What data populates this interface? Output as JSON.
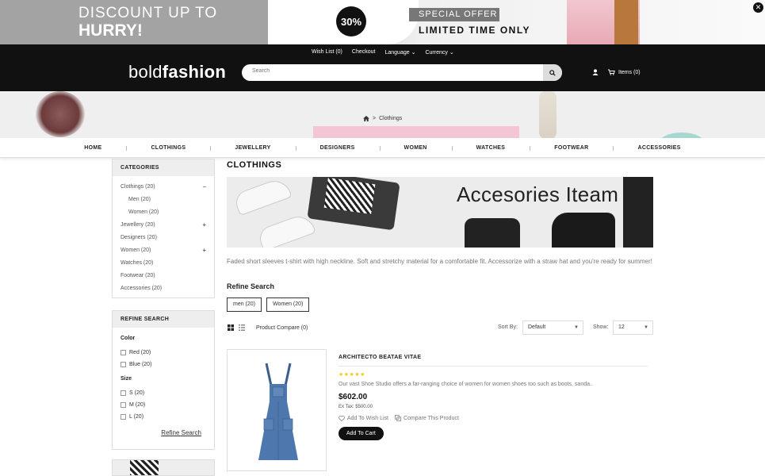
{
  "promo": {
    "line1": "DISCOUNT UP TO",
    "line2": "HURRY!",
    "percent": "30%",
    "special": "SPECIAL OFFER",
    "limited": "LIMITED TIME ONLY"
  },
  "header": {
    "toplinks": [
      "Wish List (0)",
      "Checkout",
      "Language",
      "Currency"
    ],
    "logo_light": "bold",
    "logo_bold": "fashion",
    "search_placeholder": "Search",
    "cart": "Items (0)"
  },
  "breadcrumb": {
    "current": "Clothings"
  },
  "nav": [
    "HOME",
    "CLOTHINGS",
    "JEWELLERY",
    "DESIGNERS",
    "WOMEN",
    "WATCHES",
    "FOOTWEAR",
    "ACCESSORIES"
  ],
  "sidebar": {
    "categories_title": "CATEGORIES",
    "categories": [
      {
        "label": "Clothings (20)",
        "toggle": "−"
      },
      {
        "label": "Men (20)",
        "sub": true
      },
      {
        "label": "Women (20)",
        "sub": true
      },
      {
        "label": "Jewellery (20)",
        "toggle": "+"
      },
      {
        "label": "Designers (20)"
      },
      {
        "label": "Women (20)",
        "toggle": "+"
      },
      {
        "label": "Watches (20)"
      },
      {
        "label": "Footwear (20)"
      },
      {
        "label": "Accessories (20)"
      }
    ],
    "refine_title": "REFINE SEARCH",
    "color_label": "Color",
    "colors": [
      "Red (20)",
      "Blue (20)"
    ],
    "size_label": "Size",
    "sizes": [
      "S (20)",
      "M (20)",
      "L (20)"
    ],
    "refine_link": "Refine Search"
  },
  "main": {
    "title": "CLOTHINGS",
    "hero_text": "Accesories Iteam",
    "description": "Faded short sleeves t-shirt with high neckline. Soft and stretchy material for a comfortable fit. Accessorize with a straw hat and you're ready for summer!",
    "refine_title": "Refine Search",
    "filters": [
      "men (20)",
      "Women (20)"
    ],
    "compare": "Product Compare (0)",
    "sort_label": "Sort By:",
    "sort_value": "Default",
    "show_label": "Show:",
    "show_value": "12"
  },
  "product": {
    "name": "ARCHITECTO BEATAE VITAE",
    "stars": "★★★★★",
    "rating": 5,
    "description": "Our vast Shoe Studio offers a far-ranging choice of women for women shoes too such as boots, sanda..",
    "price": "$602.00",
    "tax": "Ex Tax: $500.00",
    "wishlist": "Add To Wish List",
    "compare": "Compare This Product",
    "add_to_cart": "Add To Cart"
  }
}
